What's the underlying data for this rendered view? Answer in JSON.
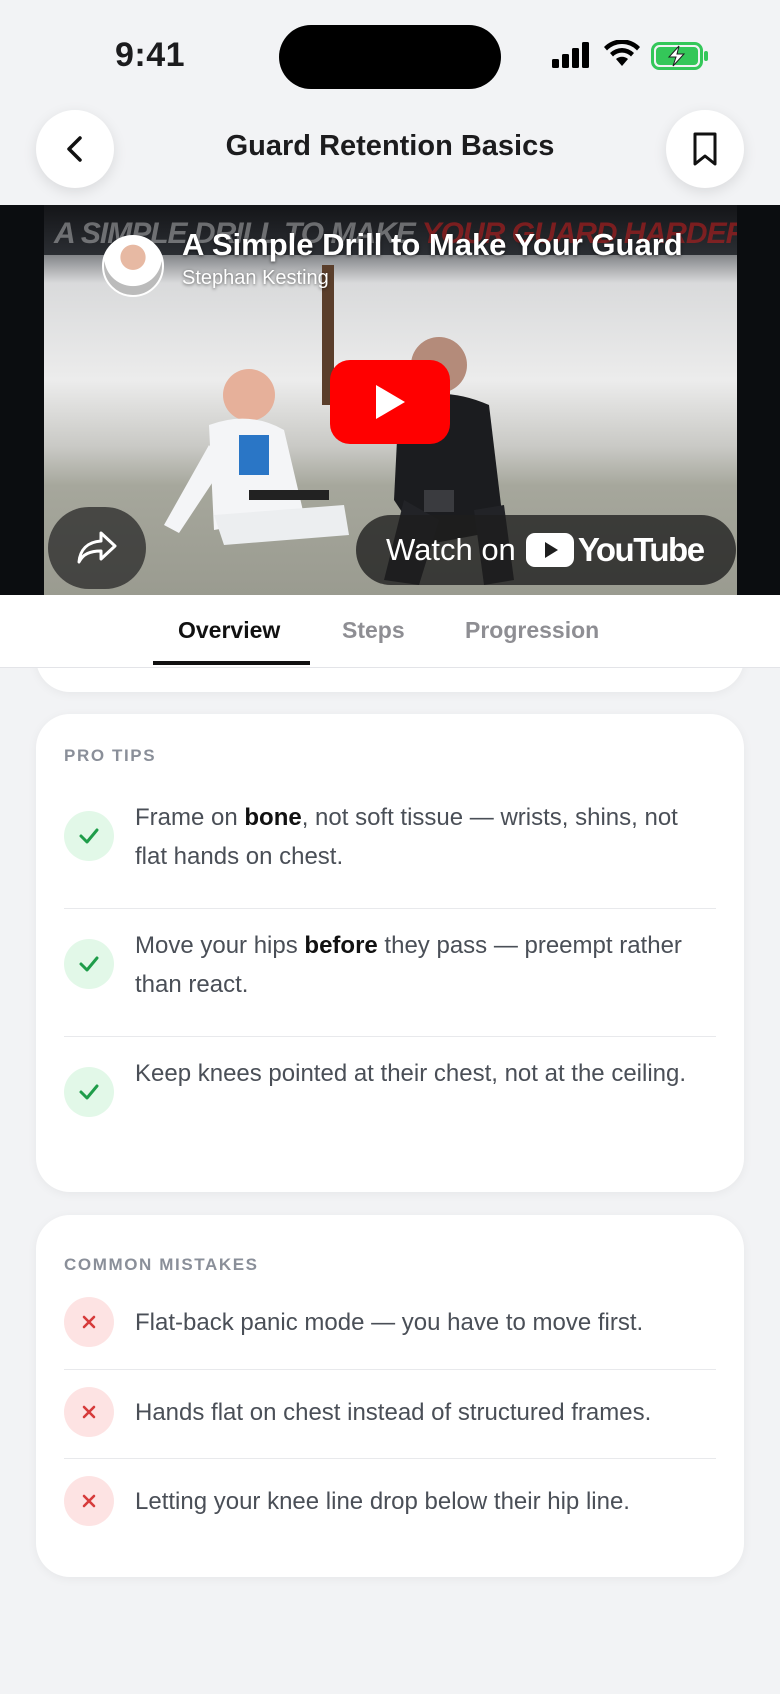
{
  "status_bar": {
    "time": "9:41"
  },
  "header": {
    "title": "Guard Retention Basics"
  },
  "video": {
    "title": "A Simple Drill to Make Your Guard",
    "channel": "Stephan Kesting",
    "banner_text_left": "A SIMPLE DRILL TO MAKE",
    "banner_text_right": "YOUR GUARD HARDER TO PASS",
    "watch_on": "Watch on",
    "platform": "YouTube"
  },
  "tabs": [
    {
      "label": "Overview",
      "active": true
    },
    {
      "label": "Steps",
      "active": false
    },
    {
      "label": "Progression",
      "active": false
    }
  ],
  "pro_tips": {
    "title": "PRO TIPS",
    "items": [
      {
        "pre": "Frame on ",
        "bold": "bone",
        "post": ", not soft tissue — wrists, shins, not flat hands on chest."
      },
      {
        "pre": "Move your hips ",
        "bold": "before",
        "post": " they pass — preempt rather than react."
      },
      {
        "pre": "Keep knees pointed at their chest, not at the ceiling.",
        "bold": "",
        "post": ""
      }
    ]
  },
  "common_mistakes": {
    "title": "COMMON MISTAKES",
    "items": [
      "Flat-back panic mode — you have to move first.",
      "Hands flat on chest instead of structured frames.",
      "Letting your knee line drop below their hip line."
    ]
  },
  "colors": {
    "ok_icon": "#1f9d4a",
    "ok_bg": "#e2f8e8",
    "bad_icon": "#d63b3b",
    "bad_bg": "#fde3e3",
    "youtube_red": "#ff0000"
  }
}
